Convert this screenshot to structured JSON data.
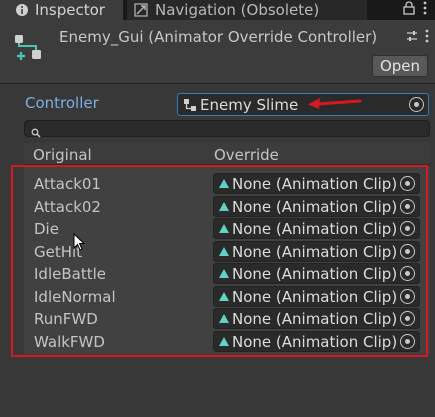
{
  "tabs": {
    "inspector": "Inspector",
    "navigation": "Navigation (Obsolete)"
  },
  "header": {
    "title": "Enemy_Gui (Animator Override Controller)",
    "open_label": "Open"
  },
  "controller": {
    "label": "Controller",
    "value": "Enemy Slime"
  },
  "search": {
    "value": ""
  },
  "table": {
    "col_original": "Original",
    "col_override": "Override",
    "rows": [
      {
        "original": "Attack01",
        "override": "None (Animation Clip)"
      },
      {
        "original": "Attack02",
        "override": "None (Animation Clip)"
      },
      {
        "original": "Die",
        "override": "None (Animation Clip)"
      },
      {
        "original": "GetHit",
        "override": "None (Animation Clip)"
      },
      {
        "original": "IdleBattle",
        "override": "None (Animation Clip)"
      },
      {
        "original": "IdleNormal",
        "override": "None (Animation Clip)"
      },
      {
        "original": "RunFWD",
        "override": "None (Animation Clip)"
      },
      {
        "original": "WalkFWD",
        "override": "None (Animation Clip)"
      }
    ]
  },
  "colors": {
    "accent_blue": "#7bafe6",
    "annotation_red": "#d6191f",
    "clip_icon": "#5fd3c6"
  },
  "icons": {
    "inspector": "info-icon",
    "navigation": "navigation-icon",
    "lock": "lock-icon",
    "menu": "kebab-menu-icon",
    "header": "animator-override-icon",
    "controller": "animator-controller-icon",
    "clip": "animation-clip-icon",
    "picker": "object-picker-icon",
    "search": "search-icon"
  }
}
